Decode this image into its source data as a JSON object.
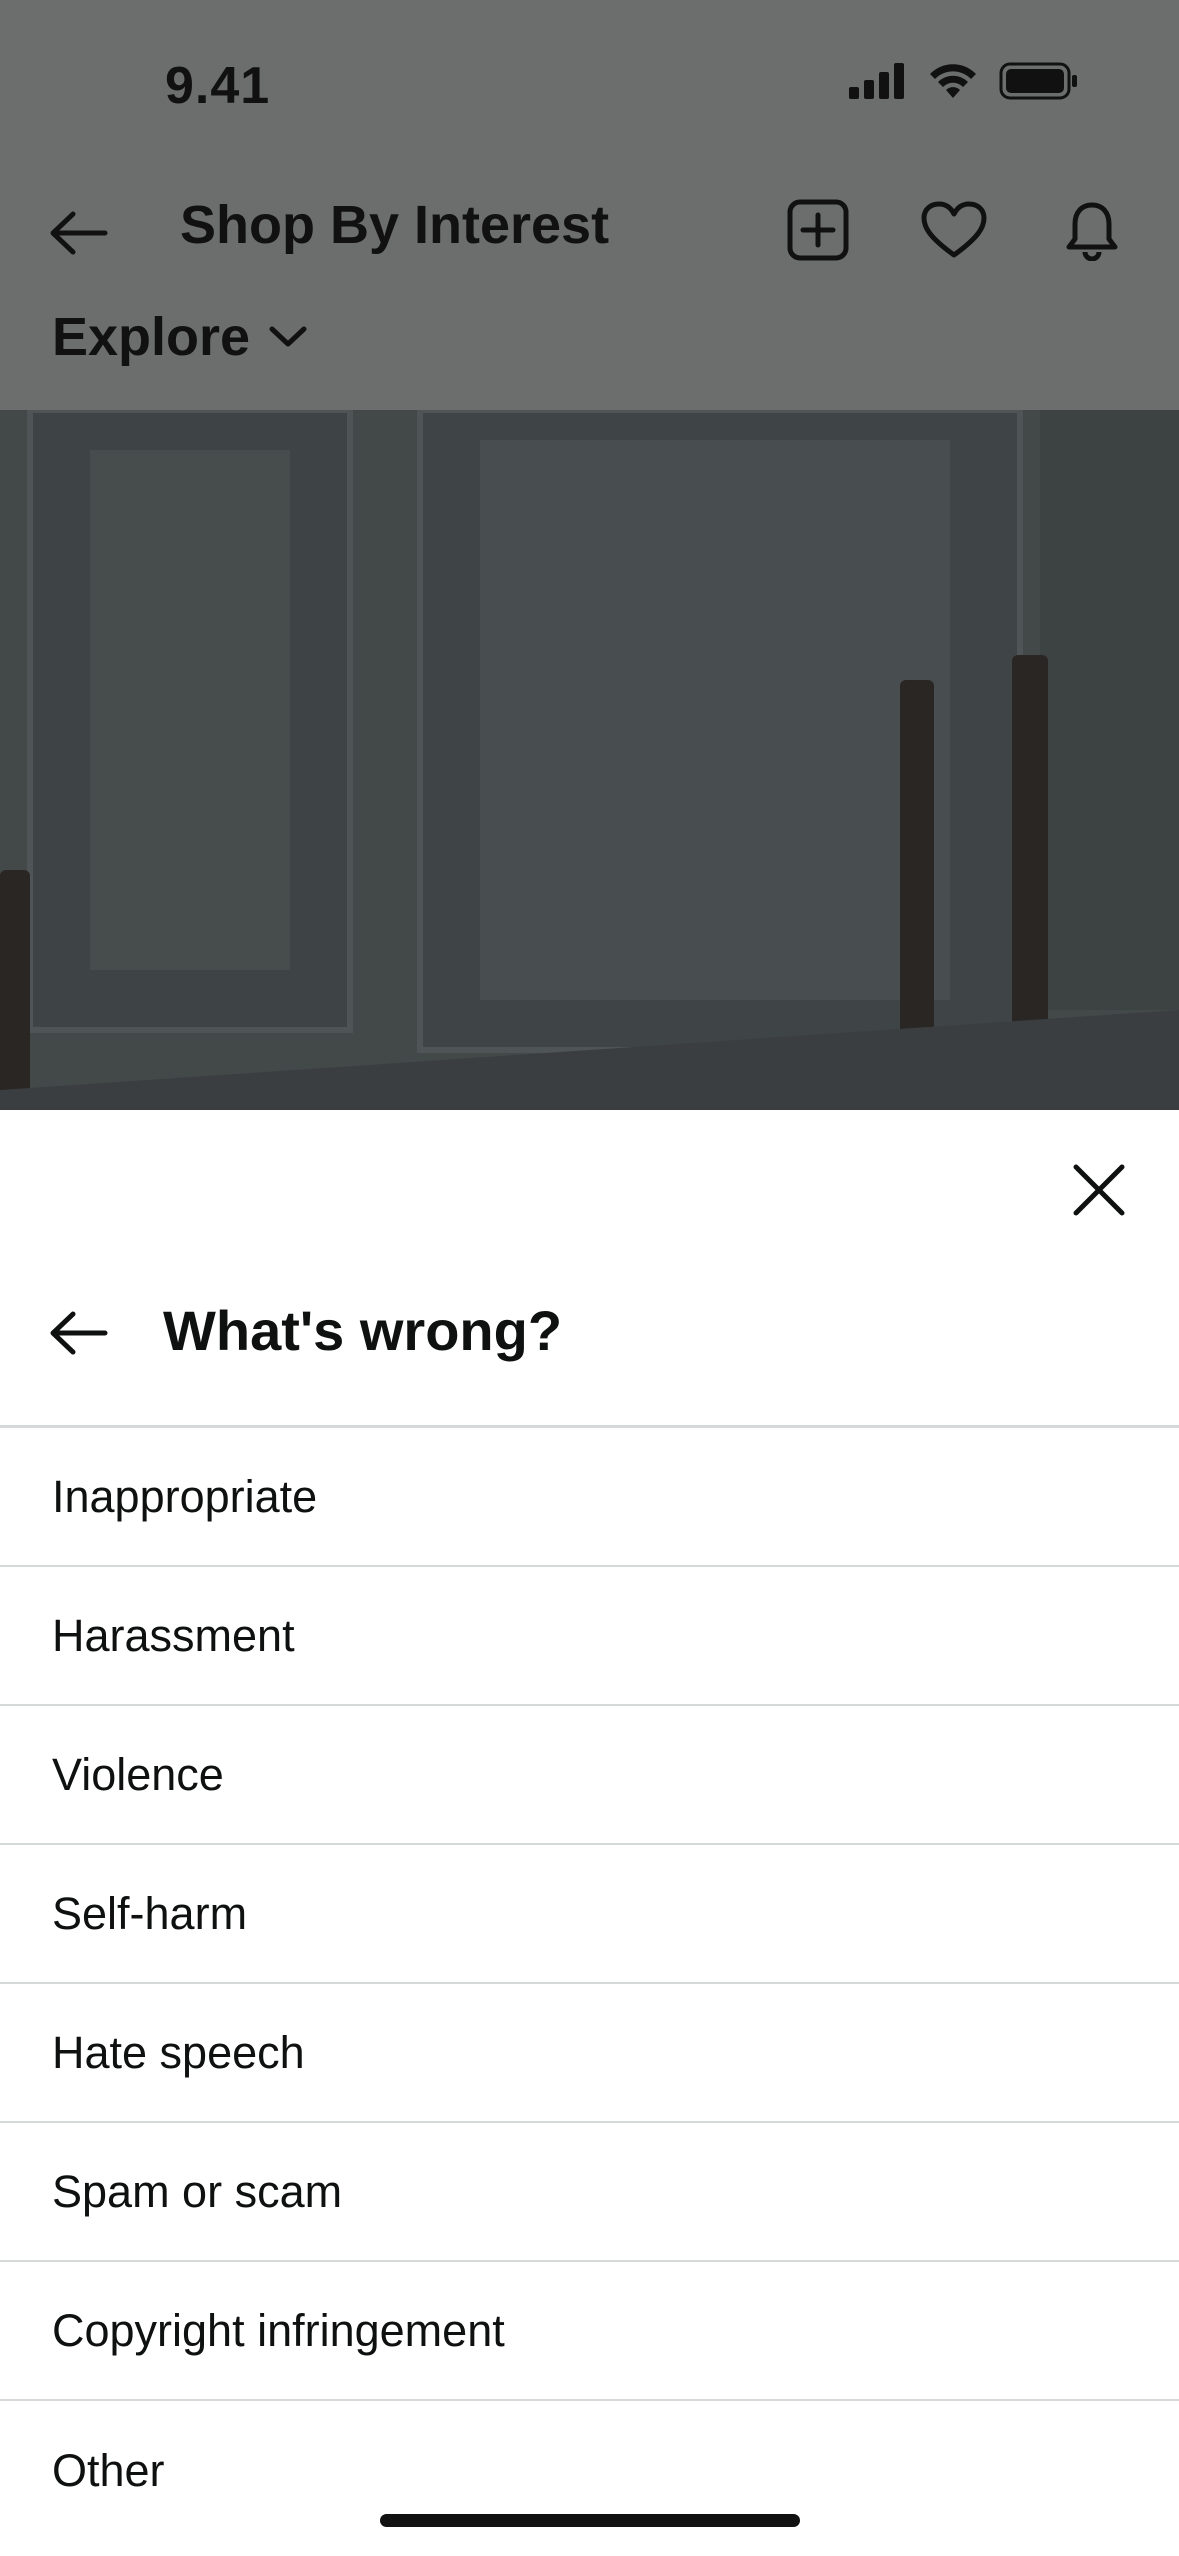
{
  "status_bar": {
    "time": "9.41"
  },
  "header": {
    "title": "Shop By Interest",
    "explore_label": "Explore"
  },
  "sheet": {
    "title": "What's wrong?",
    "options": [
      "Inappropriate",
      "Harassment",
      "Violence",
      "Self-harm",
      "Hate speech",
      "Spam or scam",
      "Copyright infringement",
      "Other"
    ]
  },
  "colors": {
    "overlay_bar": "#6b6e6d",
    "text": "#0f1111",
    "divider": "#d5d9d9"
  },
  "icons": [
    "back-arrow-icon",
    "add-square-icon",
    "heart-icon",
    "bell-icon",
    "chevron-down-icon",
    "close-icon",
    "signal-icon",
    "wifi-icon",
    "battery-icon"
  ]
}
